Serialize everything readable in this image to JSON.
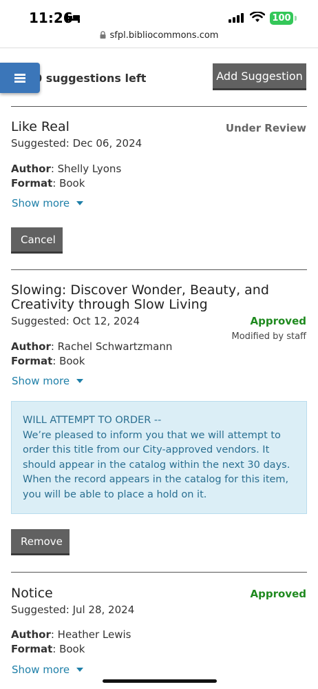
{
  "status_bar": {
    "time": "11:26",
    "battery": "100",
    "battery_color": "#34c759"
  },
  "url_bar": {
    "url": "sfpl.bibliocommons.com"
  },
  "header": {
    "menu_icon": "hamburger-icon",
    "suggestions_left": "0 suggestions left",
    "add_suggestion_label": "Add Suggestion"
  },
  "suggestions": [
    {
      "title": "Like Real",
      "date": "Suggested: Dec 06, 2024",
      "status": "Under Review",
      "author_label": "Author",
      "author": ": Shelly Lyons",
      "format_label": "Format",
      "format": ": Book",
      "show_more": "Show more",
      "action_label": "Cancel"
    },
    {
      "title": "Slowing: Discover Wonder, Beauty, and Creativity through Slow Living",
      "date": "Suggested: Oct 12, 2024",
      "status": "Approved",
      "modified": "Modified by staff",
      "author_label": "Author",
      "author": ": Rachel Schwartzmann",
      "format_label": "Format",
      "format": ": Book",
      "show_more": "Show more",
      "notice_heading": "WILL ATTEMPT TO ORDER --",
      "notice_body": "We’re pleased to inform you that we will attempt to order this title from our City-approved vendors. It should appear in the catalog within the next 30 days. When the record appears in the catalog for this item, you will be able to place a hold on it.",
      "action_label": "Remove"
    },
    {
      "title": "Notice",
      "date": "Suggested: Jul 28, 2024",
      "status": "Approved",
      "author_label": "Author",
      "author": ": Heather Lewis",
      "format_label": "Format",
      "format": ": Book",
      "show_more": "Show more"
    }
  ],
  "colors": {
    "menu_button": "#3b76b9",
    "approved": "#1f8a1f",
    "link": "#1e7fa8",
    "notice_bg": "#dbeef6"
  }
}
